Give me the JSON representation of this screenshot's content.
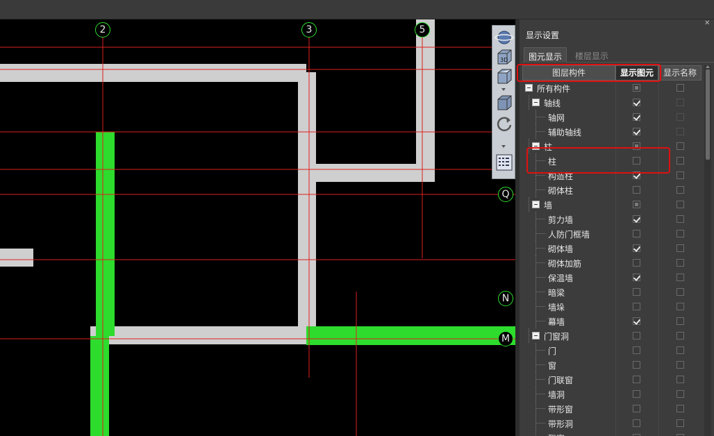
{
  "canvas": {
    "axis_labels": {
      "top": [
        "2",
        "3",
        "5"
      ],
      "right": [
        "Q",
        "N",
        "M"
      ]
    }
  },
  "view_tools": [
    "orbit-icon",
    "3d-view-icon",
    "top-view-icon",
    "box-view-icon",
    "rotate-icon",
    "grid-settings-icon"
  ],
  "panel": {
    "title": "显示设置",
    "tabs": [
      {
        "label": "图元显示",
        "active": true
      },
      {
        "label": "楼层显示",
        "active": false
      }
    ],
    "columns": [
      "图层构件",
      "显示图元",
      "显示名称"
    ],
    "rows": [
      {
        "label": "所有构件",
        "level": 0,
        "expander": true,
        "show_element": "partial",
        "show_name": "unchecked"
      },
      {
        "label": "轴线",
        "level": 1,
        "expander": true,
        "show_element": "checked",
        "show_name": "disabled"
      },
      {
        "label": "轴网",
        "level": 2,
        "expander": false,
        "show_element": "checked",
        "show_name": "disabled"
      },
      {
        "label": "辅助轴线",
        "level": 2,
        "expander": false,
        "show_element": "checked",
        "show_name": "disabled"
      },
      {
        "label": "柱",
        "level": 1,
        "expander": true,
        "show_element": "partial",
        "show_name": "unchecked"
      },
      {
        "label": "柱",
        "level": 2,
        "expander": false,
        "show_element": "unchecked",
        "show_name": "unchecked"
      },
      {
        "label": "构造柱",
        "level": 2,
        "expander": false,
        "show_element": "checked",
        "show_name": "unchecked"
      },
      {
        "label": "砌体柱",
        "level": 2,
        "expander": false,
        "show_element": "unchecked",
        "show_name": "unchecked"
      },
      {
        "label": "墙",
        "level": 1,
        "expander": true,
        "show_element": "partial",
        "show_name": "unchecked"
      },
      {
        "label": "剪力墙",
        "level": 2,
        "expander": false,
        "show_element": "checked",
        "show_name": "unchecked"
      },
      {
        "label": "人防门框墙",
        "level": 2,
        "expander": false,
        "show_element": "unchecked",
        "show_name": "unchecked"
      },
      {
        "label": "砌体墙",
        "level": 2,
        "expander": false,
        "show_element": "checked",
        "show_name": "unchecked"
      },
      {
        "label": "砌体加筋",
        "level": 2,
        "expander": false,
        "show_element": "unchecked",
        "show_name": "unchecked"
      },
      {
        "label": "保温墙",
        "level": 2,
        "expander": false,
        "show_element": "checked",
        "show_name": "unchecked"
      },
      {
        "label": "暗梁",
        "level": 2,
        "expander": false,
        "show_element": "unchecked",
        "show_name": "unchecked"
      },
      {
        "label": "墙垛",
        "level": 2,
        "expander": false,
        "show_element": "unchecked",
        "show_name": "unchecked"
      },
      {
        "label": "幕墙",
        "level": 2,
        "expander": false,
        "show_element": "checked",
        "show_name": "unchecked"
      },
      {
        "label": "门窗洞",
        "level": 1,
        "expander": true,
        "show_element": "unchecked",
        "show_name": "unchecked"
      },
      {
        "label": "门",
        "level": 2,
        "expander": false,
        "show_element": "unchecked",
        "show_name": "unchecked"
      },
      {
        "label": "窗",
        "level": 2,
        "expander": false,
        "show_element": "unchecked",
        "show_name": "unchecked"
      },
      {
        "label": "门联窗",
        "level": 2,
        "expander": false,
        "show_element": "unchecked",
        "show_name": "unchecked"
      },
      {
        "label": "墙洞",
        "level": 2,
        "expander": false,
        "show_element": "unchecked",
        "show_name": "unchecked"
      },
      {
        "label": "带形窗",
        "level": 2,
        "expander": false,
        "show_element": "unchecked",
        "show_name": "unchecked"
      },
      {
        "label": "带形洞",
        "level": 2,
        "expander": false,
        "show_element": "unchecked",
        "show_name": "unchecked"
      },
      {
        "label": "飘窗",
        "level": 2,
        "expander": false,
        "show_element": "unchecked",
        "show_name": "unchecked"
      }
    ]
  },
  "colors": {
    "axis_line": "#dd1f1f",
    "wall_gray": "#cfcfcf",
    "shear_wall_green": "#2ddc2d",
    "highlight_red": "#e01010"
  }
}
